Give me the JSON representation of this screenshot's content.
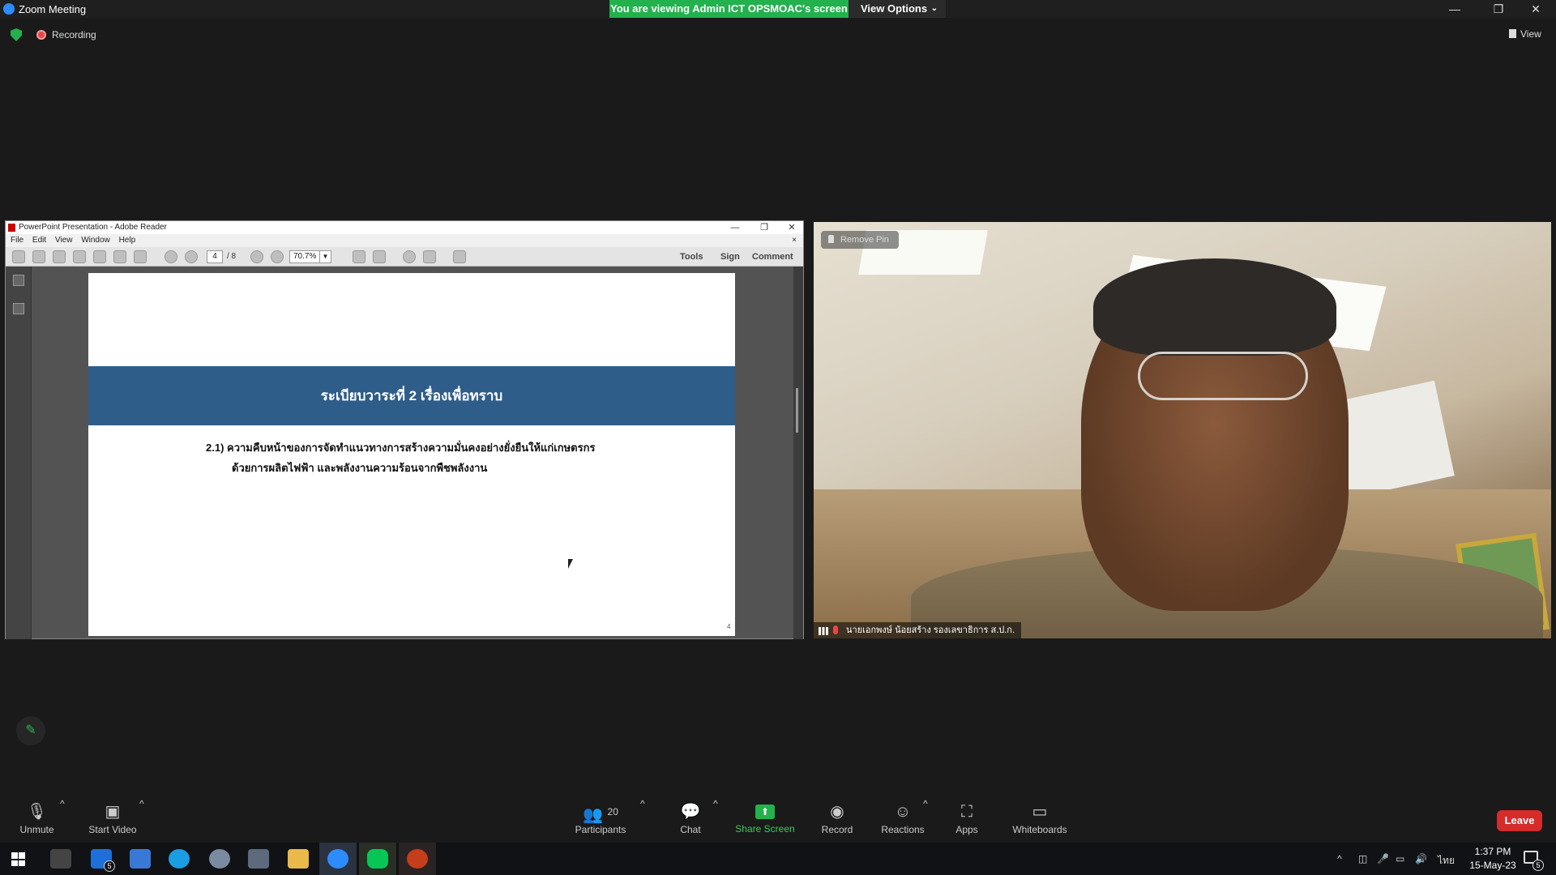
{
  "window": {
    "title": "Zoom Meeting",
    "viewing_banner": "You are viewing Admin ICT OPSMOAC's screen",
    "view_options": "View Options",
    "minimize": "—",
    "restore": "❐",
    "close": "✕"
  },
  "status": {
    "recording": "Recording",
    "view": "View"
  },
  "reader": {
    "title": "PowerPoint Presentation - Adobe Reader",
    "menu": [
      "File",
      "Edit",
      "View",
      "Window",
      "Help"
    ],
    "page_current": "4",
    "page_total": "/ 8",
    "zoom": "70.7%",
    "tools": "Tools",
    "sign": "Sign",
    "comment": "Comment"
  },
  "slide": {
    "heading": "ระเบียบวาระที่ 2 เรื่องเพื่อทราบ",
    "line1": "2.1) ความคืบหน้าของการจัดทำแนวทางการสร้างความมั่นคงอย่างยั่งยืนให้แก่เกษตรกร",
    "line2": "ด้วยการผลิตไฟฟ้า และพลังงานความร้อนจากพืชพลังงาน",
    "page_number": "4"
  },
  "video": {
    "remove_pin": "Remove Pin",
    "participant_name": "นายเอกพงษ์ น้อยสร้าง รองเลขาธิการ ส.ป.ก."
  },
  "toolbar": {
    "unmute": "Unmute",
    "start_video": "Start Video",
    "participants": "Participants",
    "participants_count": "20",
    "chat": "Chat",
    "share_screen": "Share Screen",
    "record": "Record",
    "reactions": "Reactions",
    "apps": "Apps",
    "whiteboards": "Whiteboards",
    "leave": "Leave"
  },
  "taskbar": {
    "mail_badge": "5",
    "language": "ไทย",
    "time": "1:37 PM",
    "date": "15-May-23",
    "notification_count": "5"
  },
  "colors": {
    "accent_green": "#23b14d",
    "leave_red": "#d52b2b",
    "slide_band": "#2f5d8a",
    "zoom_blue": "#2d8cff"
  }
}
